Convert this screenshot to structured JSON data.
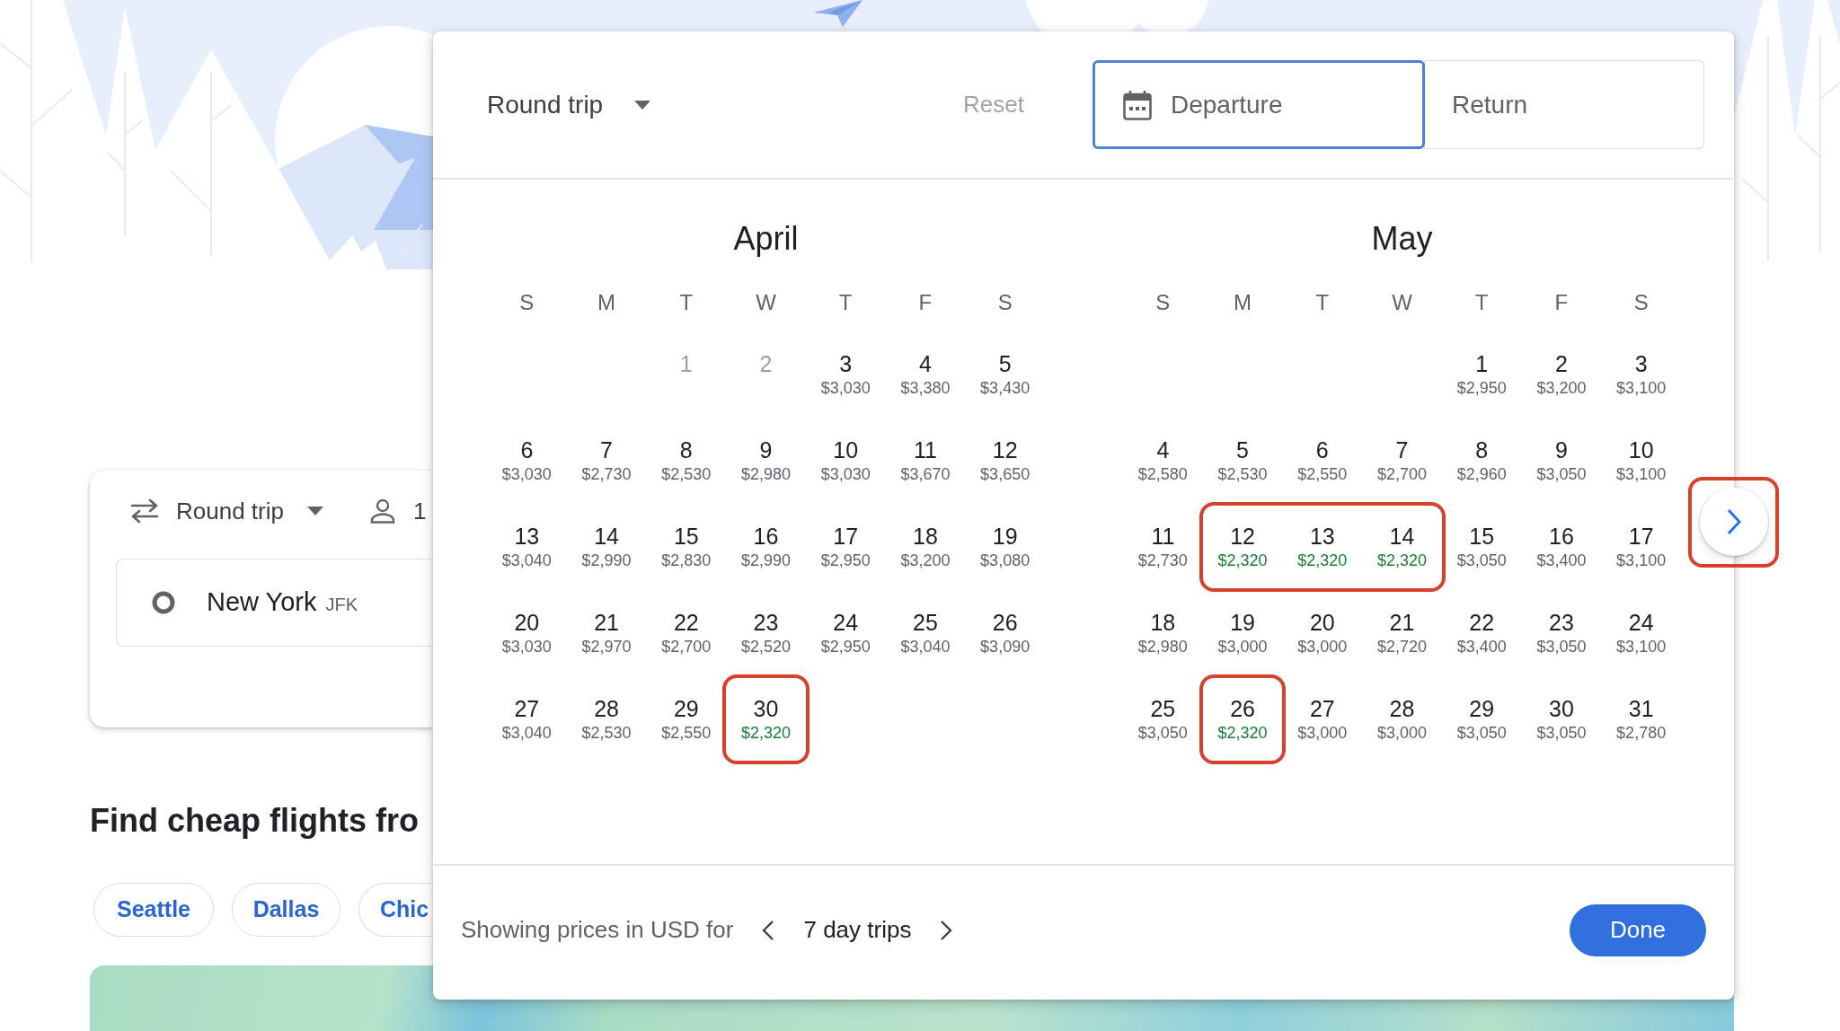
{
  "background_page": {
    "search_card": {
      "trip_type": "Round trip",
      "passengers": "1",
      "origin_city": "New York",
      "origin_code": "JFK"
    },
    "section_title": "Find cheap flights fro",
    "destination_chips": [
      "Seattle",
      "Dallas",
      "Chic"
    ]
  },
  "date_picker": {
    "trip_type": "Round trip",
    "reset": {
      "label": "Reset",
      "disabled": true
    },
    "date_fields": [
      {
        "label": "Departure",
        "selected": true
      },
      {
        "label": "Return",
        "selected": false
      }
    ],
    "months": [
      {
        "title": "April",
        "weekdays": [
          "S",
          "M",
          "T",
          "W",
          "T",
          "F",
          "S"
        ],
        "weeks": [
          {
            "starts_midweek": true,
            "days": [
              {
                "date": "1",
                "disabled": true,
                "cheapest": false,
                "highlighted": false
              },
              {
                "date": "2",
                "disabled": true,
                "cheapest": false,
                "highlighted": false
              },
              {
                "date": "3",
                "price": "$3,030",
                "disabled": false,
                "cheapest": false,
                "highlighted": false
              },
              {
                "date": "4",
                "price": "$3,380",
                "disabled": false,
                "cheapest": false,
                "highlighted": false
              },
              {
                "date": "5",
                "price": "$3,430",
                "disabled": false,
                "cheapest": false,
                "highlighted": false
              }
            ]
          },
          {
            "starts_midweek": false,
            "days": [
              {
                "date": "6",
                "price": "$3,030",
                "disabled": false,
                "cheapest": false,
                "highlighted": false
              },
              {
                "date": "7",
                "price": "$2,730",
                "disabled": false,
                "cheapest": false,
                "highlighted": false
              },
              {
                "date": "8",
                "price": "$2,530",
                "disabled": false,
                "cheapest": false,
                "highlighted": false
              },
              {
                "date": "9",
                "price": "$2,980",
                "disabled": false,
                "cheapest": false,
                "highlighted": false
              },
              {
                "date": "10",
                "price": "$3,030",
                "disabled": false,
                "cheapest": false,
                "highlighted": false
              },
              {
                "date": "11",
                "price": "$3,670",
                "disabled": false,
                "cheapest": false,
                "highlighted": false
              },
              {
                "date": "12",
                "price": "$3,650",
                "disabled": false,
                "cheapest": false,
                "highlighted": false
              }
            ]
          },
          {
            "starts_midweek": false,
            "days": [
              {
                "date": "13",
                "price": "$3,040",
                "disabled": false,
                "cheapest": false,
                "highlighted": false
              },
              {
                "date": "14",
                "price": "$2,990",
                "disabled": false,
                "cheapest": false,
                "highlighted": false
              },
              {
                "date": "15",
                "price": "$2,830",
                "disabled": false,
                "cheapest": false,
                "highlighted": false
              },
              {
                "date": "16",
                "price": "$2,990",
                "disabled": false,
                "cheapest": false,
                "highlighted": false
              },
              {
                "date": "17",
                "price": "$2,950",
                "disabled": false,
                "cheapest": false,
                "highlighted": false
              },
              {
                "date": "18",
                "price": "$3,200",
                "disabled": false,
                "cheapest": false,
                "highlighted": false
              },
              {
                "date": "19",
                "price": "$3,080",
                "disabled": false,
                "cheapest": false,
                "highlighted": false
              }
            ]
          },
          {
            "starts_midweek": false,
            "days": [
              {
                "date": "20",
                "price": "$3,030",
                "disabled": false,
                "cheapest": false,
                "highlighted": false
              },
              {
                "date": "21",
                "price": "$2,970",
                "disabled": false,
                "cheapest": false,
                "highlighted": false
              },
              {
                "date": "22",
                "price": "$2,700",
                "disabled": false,
                "cheapest": false,
                "highlighted": false
              },
              {
                "date": "23",
                "price": "$2,520",
                "disabled": false,
                "cheapest": false,
                "highlighted": false
              },
              {
                "date": "24",
                "price": "$2,950",
                "disabled": false,
                "cheapest": false,
                "highlighted": false
              },
              {
                "date": "25",
                "price": "$3,040",
                "disabled": false,
                "cheapest": false,
                "highlighted": false
              },
              {
                "date": "26",
                "price": "$3,090",
                "disabled": false,
                "cheapest": false,
                "highlighted": false
              }
            ]
          },
          {
            "starts_midweek": false,
            "days": [
              {
                "date": "27",
                "price": "$3,040",
                "disabled": false,
                "cheapest": false,
                "highlighted": false
              },
              {
                "date": "28",
                "price": "$2,530",
                "disabled": false,
                "cheapest": false,
                "highlighted": false
              },
              {
                "date": "29",
                "price": "$2,550",
                "disabled": false,
                "cheapest": false,
                "highlighted": false
              },
              {
                "date": "30",
                "price": "$2,320",
                "disabled": false,
                "cheapest": true,
                "highlighted": true
              }
            ]
          }
        ]
      },
      {
        "title": "May",
        "weekdays": [
          "S",
          "M",
          "T",
          "W",
          "T",
          "F",
          "S"
        ],
        "weeks": [
          {
            "starts_midweek": true,
            "days": [
              {
                "date": "1",
                "price": "$2,950",
                "disabled": false,
                "cheapest": false,
                "highlighted": false
              },
              {
                "date": "2",
                "price": "$3,200",
                "disabled": false,
                "cheapest": false,
                "highlighted": false
              },
              {
                "date": "3",
                "price": "$3,100",
                "disabled": false,
                "cheapest": false,
                "highlighted": false
              }
            ]
          },
          {
            "starts_midweek": false,
            "days": [
              {
                "date": "4",
                "price": "$2,580",
                "disabled": false,
                "cheapest": false,
                "highlighted": false
              },
              {
                "date": "5",
                "price": "$2,530",
                "disabled": false,
                "cheapest": false,
                "highlighted": false
              },
              {
                "date": "6",
                "price": "$2,550",
                "disabled": false,
                "cheapest": false,
                "highlighted": false
              },
              {
                "date": "7",
                "price": "$2,700",
                "disabled": false,
                "cheapest": false,
                "highlighted": false
              },
              {
                "date": "8",
                "price": "$2,960",
                "disabled": false,
                "cheapest": false,
                "highlighted": false
              },
              {
                "date": "9",
                "price": "$3,050",
                "disabled": false,
                "cheapest": false,
                "highlighted": false
              },
              {
                "date": "10",
                "price": "$3,100",
                "disabled": false,
                "cheapest": false,
                "highlighted": false
              }
            ]
          },
          {
            "starts_midweek": false,
            "days": [
              {
                "date": "11",
                "price": "$2,730",
                "disabled": false,
                "cheapest": false,
                "highlighted": false
              },
              {
                "date": "12",
                "price": "$2,320",
                "disabled": false,
                "cheapest": true,
                "highlighted": true
              },
              {
                "date": "13",
                "price": "$2,320",
                "disabled": false,
                "cheapest": true,
                "highlighted": true
              },
              {
                "date": "14",
                "price": "$2,320",
                "disabled": false,
                "cheapest": true,
                "highlighted": true
              },
              {
                "date": "15",
                "price": "$3,050",
                "disabled": false,
                "cheapest": false,
                "highlighted": false
              },
              {
                "date": "16",
                "price": "$3,400",
                "disabled": false,
                "cheapest": false,
                "highlighted": false
              },
              {
                "date": "17",
                "price": "$3,100",
                "disabled": false,
                "cheapest": false,
                "highlighted": false
              }
            ]
          },
          {
            "starts_midweek": false,
            "days": [
              {
                "date": "18",
                "price": "$2,980",
                "disabled": false,
                "cheapest": false,
                "highlighted": false
              },
              {
                "date": "19",
                "price": "$3,000",
                "disabled": false,
                "cheapest": false,
                "highlighted": false
              },
              {
                "date": "20",
                "price": "$3,000",
                "disabled": false,
                "cheapest": false,
                "highlighted": false
              },
              {
                "date": "21",
                "price": "$2,720",
                "disabled": false,
                "cheapest": false,
                "highlighted": false
              },
              {
                "date": "22",
                "price": "$3,400",
                "disabled": false,
                "cheapest": false,
                "highlighted": false
              },
              {
                "date": "23",
                "price": "$3,050",
                "disabled": false,
                "cheapest": false,
                "highlighted": false
              },
              {
                "date": "24",
                "price": "$3,100",
                "disabled": false,
                "cheapest": false,
                "highlighted": false
              }
            ]
          },
          {
            "starts_midweek": false,
            "days": [
              {
                "date": "25",
                "price": "$3,050",
                "disabled": false,
                "cheapest": false,
                "highlighted": false
              },
              {
                "date": "26",
                "price": "$2,320",
                "disabled": false,
                "cheapest": true,
                "highlighted": true
              },
              {
                "date": "27",
                "price": "$3,000",
                "disabled": false,
                "cheapest": false,
                "highlighted": false
              },
              {
                "date": "28",
                "price": "$3,000",
                "disabled": false,
                "cheapest": false,
                "highlighted": false
              },
              {
                "date": "29",
                "price": "$3,050",
                "disabled": false,
                "cheapest": false,
                "highlighted": false
              },
              {
                "date": "30",
                "price": "$3,050",
                "disabled": false,
                "cheapest": false,
                "highlighted": false
              },
              {
                "date": "31",
                "price": "$2,780",
                "disabled": false,
                "cheapest": false,
                "highlighted": false
              }
            ]
          }
        ]
      }
    ],
    "next_month_button": {
      "highlighted": true
    },
    "footer": {
      "note": "Showing prices in USD for",
      "trip_length": "7 day trips",
      "done": "Done"
    }
  }
}
